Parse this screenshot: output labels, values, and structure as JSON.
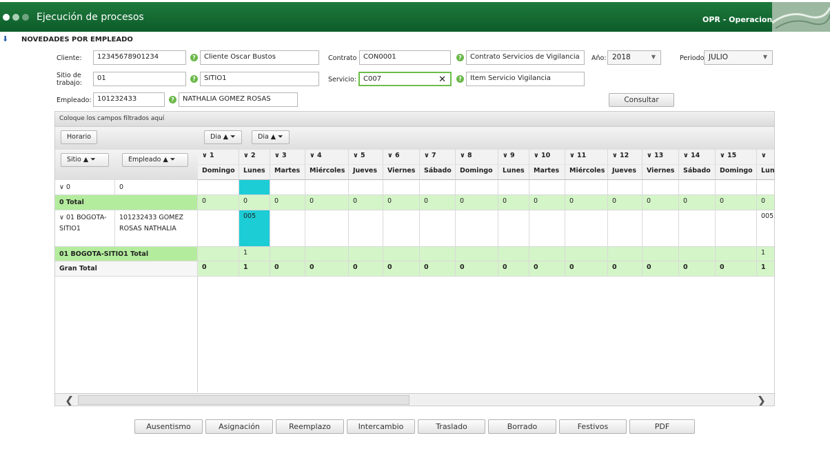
{
  "app": {
    "title": "Ejecución de procesos",
    "module": "OPR - Operaciones",
    "colors": {
      "header": "#0d5c2a",
      "accent_green": "#6bb84a",
      "cyan": "#1ccdd6",
      "total_green": "#b4ec9e",
      "light_green": "#d4f5c8"
    }
  },
  "section": {
    "icon": "info-arrow-icon",
    "title": "NOVEDADES POR EMPLEADO"
  },
  "form": {
    "cliente": {
      "label": "Cliente:",
      "value": "12345678901234",
      "desc": "Cliente Oscar Bustos"
    },
    "contrato": {
      "label": "Contrato",
      "value": "CON0001",
      "desc": "Contrato Servicios de Vigilancia"
    },
    "anio": {
      "label": "Año:",
      "value": "2018"
    },
    "periodo": {
      "label": "Periodo:",
      "value": "JULIO"
    },
    "sitio": {
      "label": "Sitio de trabajo:",
      "value": "01",
      "desc": "SITIO1"
    },
    "servicio": {
      "label": "Servicio:",
      "value": "C007",
      "desc": "Item Servicio Vigilancia"
    },
    "empleado": {
      "label": "Empleado:",
      "value": "101232433",
      "desc": "NATHALIA GOMEZ ROSAS"
    },
    "consultar": "Consultar",
    "help_glyph": "?"
  },
  "pivot": {
    "drop_zone": "Coloque los campos filtrados aquí",
    "data_field": "Horario",
    "col_fields": [
      "Dia ▲",
      "Dia ▲"
    ],
    "row_fields": [
      "Sitio ▲",
      "Empleado ▲"
    ],
    "columns": [
      {
        "num": "∨ 1",
        "day": "Domingo"
      },
      {
        "num": "∨ 2",
        "day": "Lunes"
      },
      {
        "num": "∨ 3",
        "day": "Martes"
      },
      {
        "num": "∨ 4",
        "day": "Miércoles"
      },
      {
        "num": "∨ 5",
        "day": "Jueves"
      },
      {
        "num": "∨ 6",
        "day": "Viernes"
      },
      {
        "num": "∨ 7",
        "day": "Sábado"
      },
      {
        "num": "∨ 8",
        "day": "Domingo"
      },
      {
        "num": "∨ 9",
        "day": "Lunes"
      },
      {
        "num": "∨ 10",
        "day": "Martes"
      },
      {
        "num": "∨ 11",
        "day": "Miércoles"
      },
      {
        "num": "∨ 12",
        "day": "Jueves"
      },
      {
        "num": "∨ 13",
        "day": "Viernes"
      },
      {
        "num": "∨ 14",
        "day": "Sábado"
      },
      {
        "num": "∨ 15",
        "day": "Domingo"
      },
      {
        "num": "∨ ",
        "day": "Lun"
      }
    ],
    "rows": [
      {
        "sitio": "∨ 0",
        "empleado": "0",
        "kind": "data",
        "cells": [
          "",
          "",
          "",
          "",
          "",
          "",
          "",
          "",
          "",
          "",
          "",
          "",
          "",
          "",
          "",
          ""
        ],
        "cyan": [
          1
        ]
      },
      {
        "sitio": "0 Total",
        "empleado": "",
        "kind": "total",
        "cells": [
          "0",
          "0",
          "0",
          "0",
          "0",
          "0",
          "0",
          "0",
          "0",
          "0",
          "0",
          "0",
          "0",
          "0",
          "0",
          "0"
        ],
        "cyan": []
      },
      {
        "sitio": "∨ 01 BOGOTA-SITIO1",
        "empleado": "101232433 GOMEZ ROSAS NATHALIA",
        "kind": "data",
        "cells": [
          "",
          "005",
          "",
          "",
          "",
          "",
          "",
          "",
          "",
          "",
          "",
          "",
          "",
          "",
          "",
          "005"
        ],
        "cyan": [
          1
        ]
      },
      {
        "sitio": "01 BOGOTA-SITIO1 Total",
        "empleado": "",
        "kind": "total",
        "cells": [
          "",
          "1",
          "",
          "",
          "",
          "",
          "",
          "",
          "",
          "",
          "",
          "",
          "",
          "",
          "",
          "1"
        ],
        "cyan": []
      },
      {
        "sitio": "Gran Total",
        "empleado": "",
        "kind": "grand",
        "cells": [
          "0",
          "1",
          "0",
          "0",
          "0",
          "0",
          "0",
          "0",
          "0",
          "0",
          "0",
          "0",
          "0",
          "0",
          "0",
          "1"
        ],
        "cyan": []
      }
    ]
  },
  "actions": [
    "Ausentismo",
    "Asignación",
    "Reemplazo",
    "Intercambio",
    "Traslado",
    "Borrado",
    "Festivos",
    "PDF"
  ]
}
